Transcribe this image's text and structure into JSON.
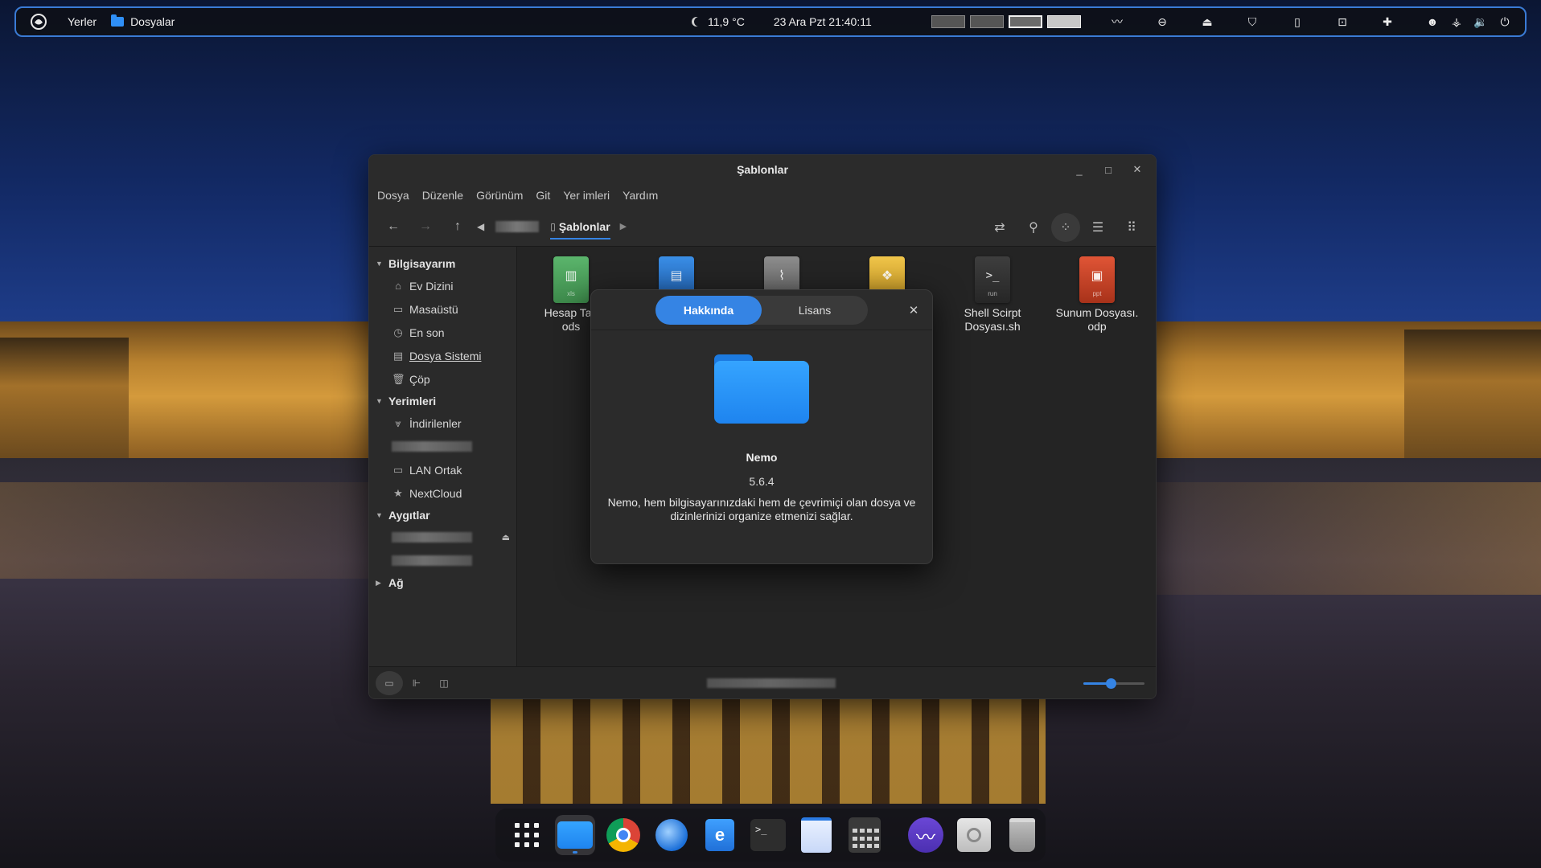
{
  "top_panel": {
    "places_label": "Yerler",
    "active_app_label": "Dosyalar",
    "weather": "11,9 °C",
    "datetime": "23 Ara Pzt  21:40:11",
    "workspace_count": 4,
    "tray_icons": [
      "wave-icon",
      "menu-dots-icon",
      "eject-icon",
      "shield-icon",
      "clipboard-icon",
      "keyboard-icon",
      "extension-icon",
      "cat-icon",
      "network-icon",
      "volume-icon",
      "power-icon"
    ]
  },
  "window": {
    "title": "Şablonlar",
    "menu": [
      "Dosya",
      "Düzenle",
      "Görünüm",
      "Git",
      "Yer imleri",
      "Yardım"
    ],
    "breadcrumb_active": "Şablonlar"
  },
  "sidebar": {
    "computer_header": "Bilgisayarım",
    "computer_items": [
      "Ev Dizini",
      "Masaüstü",
      "En son",
      "Dosya Sistemi",
      "Çöp"
    ],
    "bookmarks_header": "Yerimleri",
    "bookmark_items": [
      "İndirilenler",
      "LAN Ortak",
      "NextCloud"
    ],
    "devices_header": "Aygıtlar",
    "network_header": "Ağ"
  },
  "files": [
    {
      "name": "Hesap Tab ods",
      "line1": "Hesap Tab",
      "line2": "ods",
      "ext": "xls",
      "icon": "spreadsheet-icon"
    },
    {
      "name": "",
      "ext": "",
      "icon": "document-icon"
    },
    {
      "name": "",
      "ext": "",
      "icon": "attachment-icon"
    },
    {
      "name": "",
      "ext": "",
      "icon": "python-icon"
    },
    {
      "name": "Shell Scirpt Dosyası.sh",
      "line1": "Shell Scirpt",
      "line2": "Dosyası.sh",
      "ext": "run",
      "icon": "terminal-icon"
    },
    {
      "name": "Sunum Dosyası.odp",
      "line1": "Sunum Dosyası.",
      "line2": "odp",
      "ext": "ppt",
      "icon": "presentation-icon"
    }
  ],
  "about": {
    "tabs": [
      "Hakkında",
      "Lisans"
    ],
    "active_tab": "Hakkında",
    "app_name": "Nemo",
    "version": "5.6.4",
    "description": "Nemo, hem bilgisayarınızdaki hem de çevrimiçi olan dosya ve dizinlerinizi organize etmenizi sağlar."
  },
  "zoom_level_fraction": 0.45,
  "dock": [
    "app-grid-icon",
    "files-icon",
    "chrome-icon",
    "thunderbird-icon",
    "software-store-icon",
    "terminal-icon",
    "writer-icon",
    "calculator-icon",
    "wave-app-icon",
    "disk-icon",
    "trash-icon"
  ],
  "colors": {
    "accent": "#3584e4",
    "panel_border": "#3a7bd5",
    "folder": "#2f8ff7"
  }
}
